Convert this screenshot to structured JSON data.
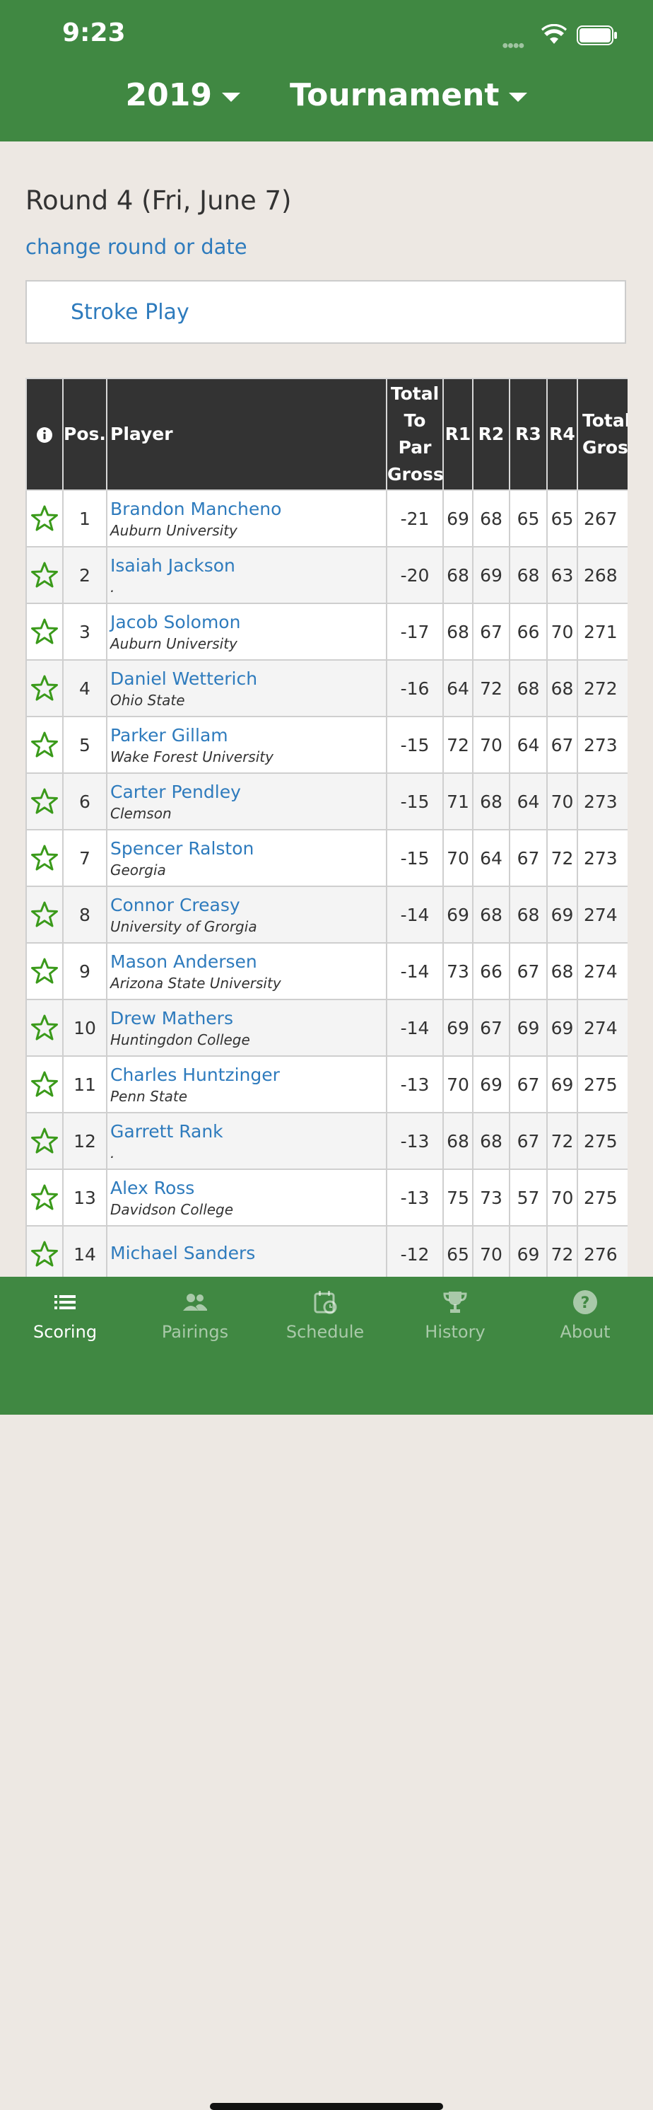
{
  "status": {
    "time": "9:23"
  },
  "header": {
    "year": "2019",
    "event": "Tournament"
  },
  "round": {
    "title": "Round 4 (Fri, June 7)",
    "change_link": "change round or date"
  },
  "format": {
    "label": "Stroke Play"
  },
  "table": {
    "headers": {
      "info": "info-icon",
      "pos": "Pos.",
      "player": "Player",
      "to_par_line1": "Total",
      "to_par_line2": "To",
      "to_par_line3": "Par",
      "to_par_line4": "Gross",
      "r1": "R1",
      "r2": "R2",
      "r3": "R3",
      "r4": "R4",
      "total_line1": "Total",
      "total_line2": "Gross"
    },
    "rows": [
      {
        "pos": "1",
        "name": "Brandon Mancheno",
        "team": "Auburn University",
        "to_par": "-21",
        "r1": "69",
        "r2": "68",
        "r3": "65",
        "r4": "65",
        "total": "267"
      },
      {
        "pos": "2",
        "name": "Isaiah Jackson",
        "team": ".",
        "to_par": "-20",
        "r1": "68",
        "r2": "69",
        "r3": "68",
        "r4": "63",
        "total": "268"
      },
      {
        "pos": "3",
        "name": "Jacob Solomon",
        "team": "Auburn University",
        "to_par": "-17",
        "r1": "68",
        "r2": "67",
        "r3": "66",
        "r4": "70",
        "total": "271"
      },
      {
        "pos": "4",
        "name": "Daniel Wetterich",
        "team": "Ohio State",
        "to_par": "-16",
        "r1": "64",
        "r2": "72",
        "r3": "68",
        "r4": "68",
        "total": "272"
      },
      {
        "pos": "5",
        "name": "Parker Gillam",
        "team": "Wake Forest University",
        "to_par": "-15",
        "r1": "72",
        "r2": "70",
        "r3": "64",
        "r4": "67",
        "total": "273"
      },
      {
        "pos": "6",
        "name": "Carter Pendley",
        "team": "Clemson",
        "to_par": "-15",
        "r1": "71",
        "r2": "68",
        "r3": "64",
        "r4": "70",
        "total": "273"
      },
      {
        "pos": "7",
        "name": "Spencer Ralston",
        "team": "Georgia",
        "to_par": "-15",
        "r1": "70",
        "r2": "64",
        "r3": "67",
        "r4": "72",
        "total": "273"
      },
      {
        "pos": "8",
        "name": "Connor Creasy",
        "team": "University of Grorgia",
        "to_par": "-14",
        "r1": "69",
        "r2": "68",
        "r3": "68",
        "r4": "69",
        "total": "274"
      },
      {
        "pos": "9",
        "name": "Mason Andersen",
        "team": "Arizona State University",
        "to_par": "-14",
        "r1": "73",
        "r2": "66",
        "r3": "67",
        "r4": "68",
        "total": "274"
      },
      {
        "pos": "10",
        "name": "Drew Mathers",
        "team": "Huntingdon College",
        "to_par": "-14",
        "r1": "69",
        "r2": "67",
        "r3": "69",
        "r4": "69",
        "total": "274"
      },
      {
        "pos": "11",
        "name": "Charles Huntzinger",
        "team": "Penn State",
        "to_par": "-13",
        "r1": "70",
        "r2": "69",
        "r3": "67",
        "r4": "69",
        "total": "275"
      },
      {
        "pos": "12",
        "name": "Garrett Rank",
        "team": ".",
        "to_par": "-13",
        "r1": "68",
        "r2": "68",
        "r3": "67",
        "r4": "72",
        "total": "275"
      },
      {
        "pos": "13",
        "name": "Alex Ross",
        "team": "Davidson College",
        "to_par": "-13",
        "r1": "75",
        "r2": "73",
        "r3": "57",
        "r4": "70",
        "total": "275"
      },
      {
        "pos": "14",
        "name": "Michael Sanders",
        "team": "",
        "to_par": "-12",
        "r1": "65",
        "r2": "70",
        "r3": "69",
        "r4": "72",
        "total": "276"
      }
    ]
  },
  "tabs": [
    {
      "label": "Scoring",
      "icon": "list-icon",
      "active": true
    },
    {
      "label": "Pairings",
      "icon": "people-icon",
      "active": false
    },
    {
      "label": "Schedule",
      "icon": "calendar-icon",
      "active": false
    },
    {
      "label": "History",
      "icon": "trophy-icon",
      "active": false
    },
    {
      "label": "About",
      "icon": "help-icon",
      "active": false
    }
  ],
  "colors": {
    "brand_green": "#408842",
    "link_blue": "#2e7bbd",
    "header_dark": "#333333",
    "star_green": "#3a9a1a"
  }
}
